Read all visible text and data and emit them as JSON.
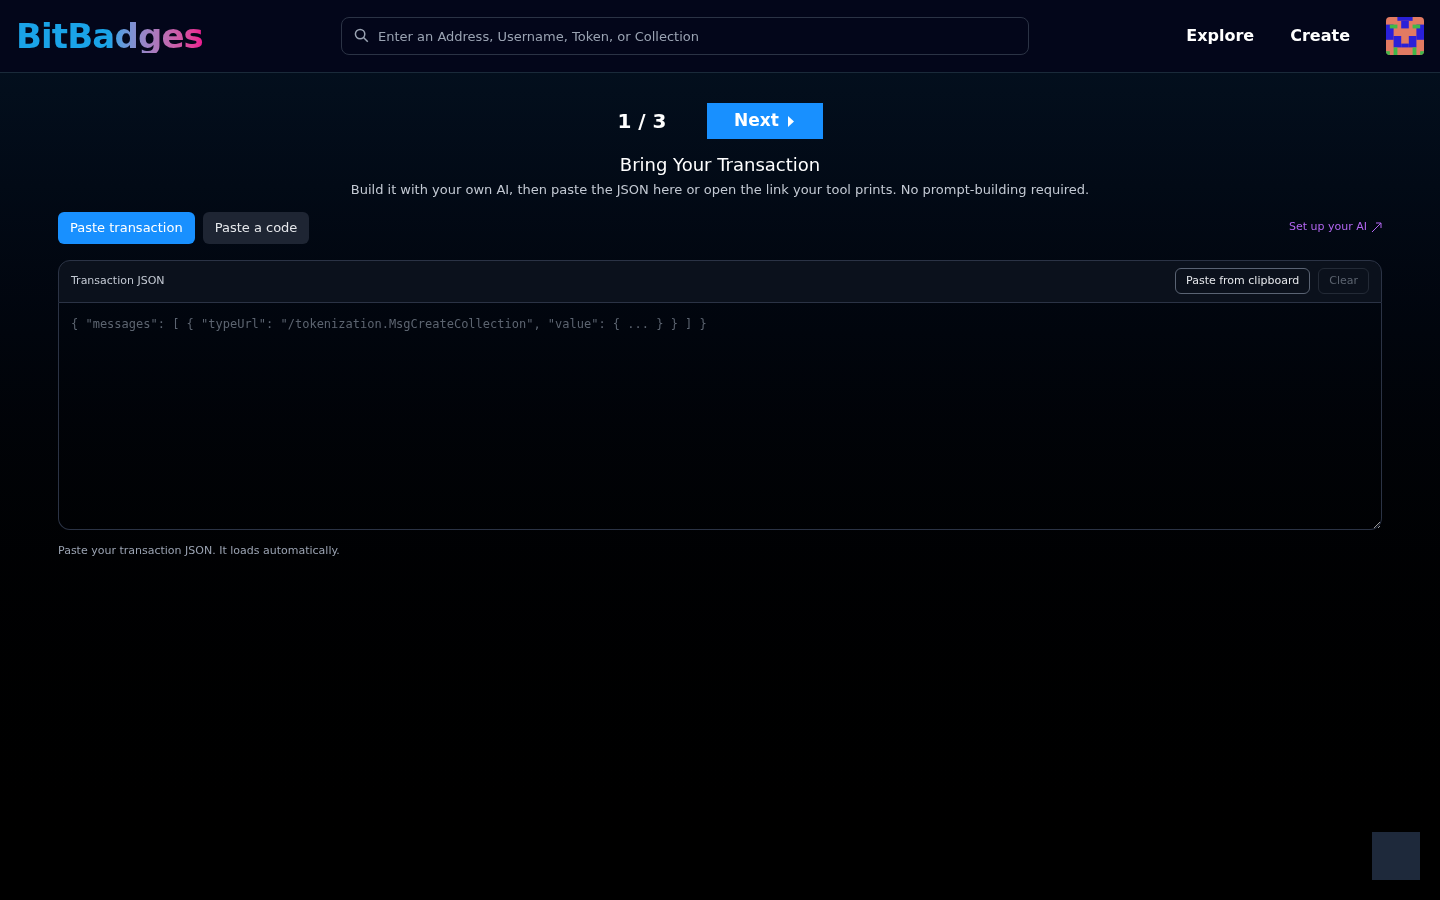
{
  "header": {
    "logo": "BitBadges",
    "search": {
      "placeholder": "Enter an Address, Username, Token, or Collection"
    },
    "nav": [
      "Explore",
      "Create"
    ]
  },
  "stepper": {
    "step": "1 / 3",
    "next": "Next"
  },
  "title": "Bring Your Transaction",
  "subtitle": "Build it with your own AI, then paste the JSON here or open the link your tool prints. No prompt-building required.",
  "tabs": [
    {
      "label": "Paste transaction",
      "selected": true
    },
    {
      "label": "Paste a code",
      "selected": false
    }
  ],
  "setup_link": "Set up your AI",
  "editor": {
    "label": "Transaction JSON",
    "buttons": [
      {
        "label": "Paste from clipboard",
        "disabled": false
      },
      {
        "label": "Clear",
        "disabled": true
      }
    ],
    "placeholder": "{ \"messages\": [ { \"typeUrl\": \"/tokenization.MsgCreateCollection\", \"value\": { ... } } ] }"
  },
  "hint": "Paste your transaction JSON. It loads automatically."
}
